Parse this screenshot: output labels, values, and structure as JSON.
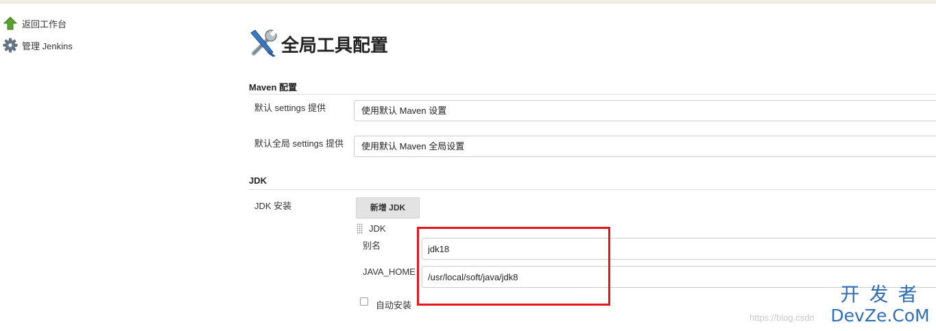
{
  "sidebar": {
    "items": [
      {
        "label": "返回工作台",
        "icon": "up-arrow-icon"
      },
      {
        "label": "管理 Jenkins",
        "icon": "gear-icon"
      }
    ]
  },
  "page": {
    "title": "全局工具配置",
    "title_icon": "tools-icon"
  },
  "maven": {
    "heading": "Maven 配置",
    "settings_label": "默认 settings 提供",
    "settings_value": "使用默认 Maven 设置",
    "global_settings_label": "默认全局 settings 提供",
    "global_settings_value": "使用默认 Maven 全局设置"
  },
  "jdk": {
    "heading": "JDK",
    "install_label": "JDK 安装",
    "add_button": "新增 JDK",
    "item_heading": "JDK",
    "name_label": "别名",
    "name_value": "jdk18",
    "home_label": "JAVA_HOME",
    "home_value": "/usr/local/soft/java/jdk8",
    "auto_install_label": "自动安装",
    "auto_install_checked": false
  },
  "watermark": {
    "url": "https://blog.csdn",
    "logo_cn": "开发者",
    "logo_en": "DevZe.CoM"
  },
  "colors": {
    "highlight": "#e8161c",
    "arrow": "#5aa02c",
    "logo": "#2f6db5"
  }
}
